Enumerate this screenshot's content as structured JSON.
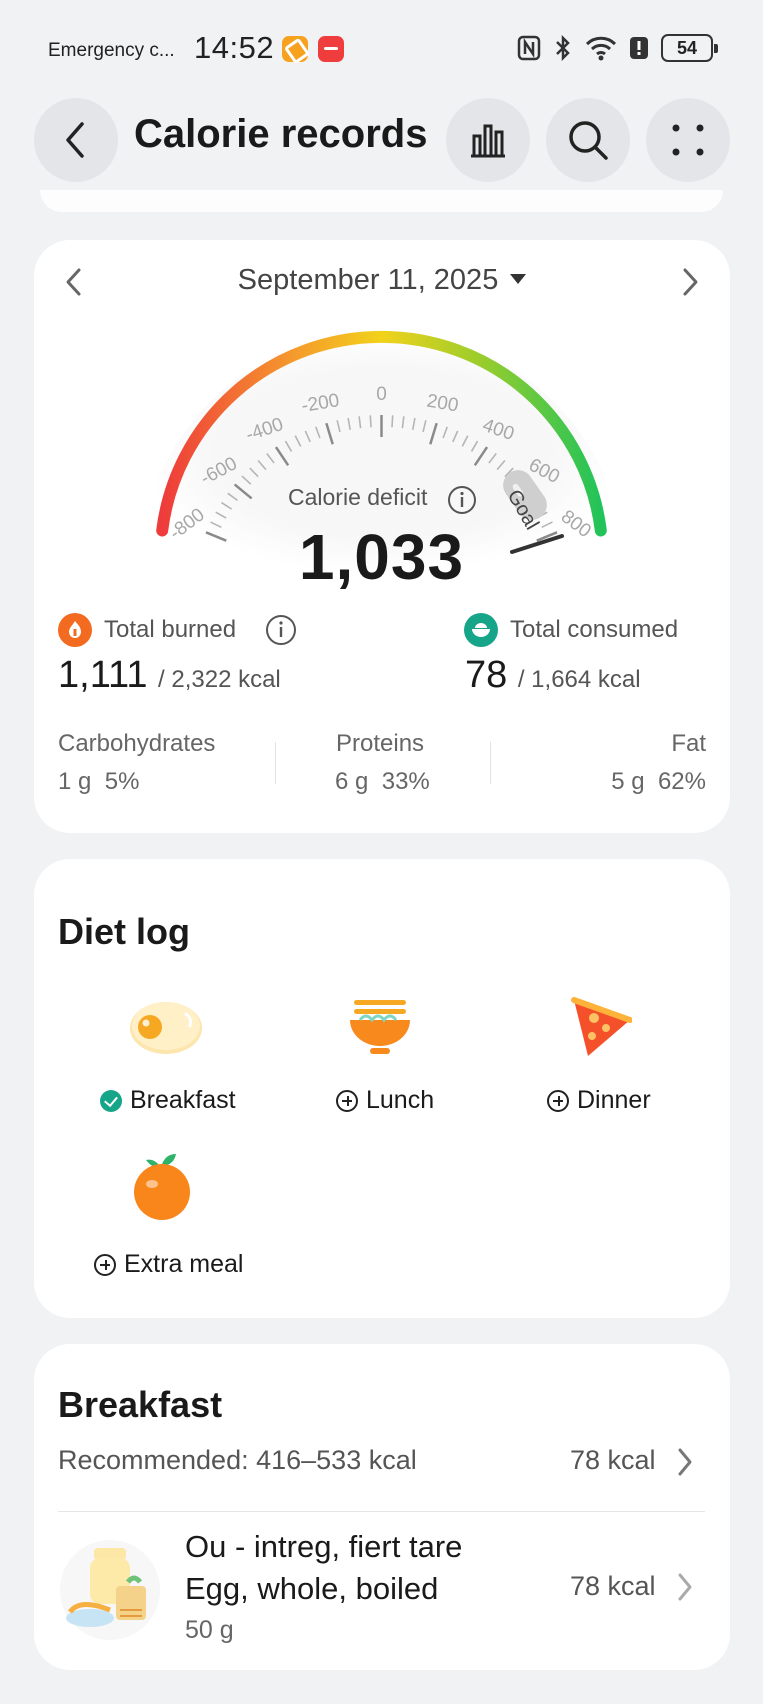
{
  "status_bar": {
    "carrier": "Emergency c...",
    "time": "14:52",
    "battery": "54"
  },
  "header": {
    "title": "Calorie records"
  },
  "summary": {
    "date": "September 11, 2025",
    "gauge_ticks": [
      "-800",
      "-600",
      "-400",
      "-200",
      "0",
      "200",
      "400",
      "600",
      "800"
    ],
    "goal_label": "Goal",
    "deficit_label": "Calorie deficit",
    "deficit_value": "1,033",
    "burned": {
      "label": "Total burned",
      "value": "1,111",
      "total": "/ 2,322 kcal"
    },
    "consumed": {
      "label": "Total consumed",
      "value": "78",
      "total": "/ 1,664 kcal"
    },
    "macros": [
      {
        "name": "Carbohydrates",
        "amount": "1 g",
        "pct": "5%"
      },
      {
        "name": "Proteins",
        "amount": "6 g",
        "pct": "33%"
      },
      {
        "name": "Fat",
        "amount": "5 g",
        "pct": "62%"
      }
    ],
    "colors": {
      "gauge_red": "#ee3b3b",
      "gauge_yellow": "#f2d21b",
      "gauge_green": "#22c35a",
      "burned_icon": "#f26b21",
      "consumed_icon": "#17a589"
    }
  },
  "diet_log": {
    "title": "Diet log",
    "meals": [
      {
        "label": "Breakfast",
        "state": "done",
        "icon": "egg-icon"
      },
      {
        "label": "Lunch",
        "state": "add",
        "icon": "noodle-bowl-icon"
      },
      {
        "label": "Dinner",
        "state": "add",
        "icon": "pizza-slice-icon"
      },
      {
        "label": "Extra meal",
        "state": "add",
        "icon": "orange-icon"
      }
    ]
  },
  "breakfast": {
    "title": "Breakfast",
    "recommended": "Recommended: 416–533 kcal",
    "total": "78 kcal",
    "items": [
      {
        "name_line1": "Ou - intreg, fiert tare",
        "name_line2": "Egg, whole, boiled",
        "amount": "50 g",
        "kcal": "78 kcal"
      }
    ]
  }
}
